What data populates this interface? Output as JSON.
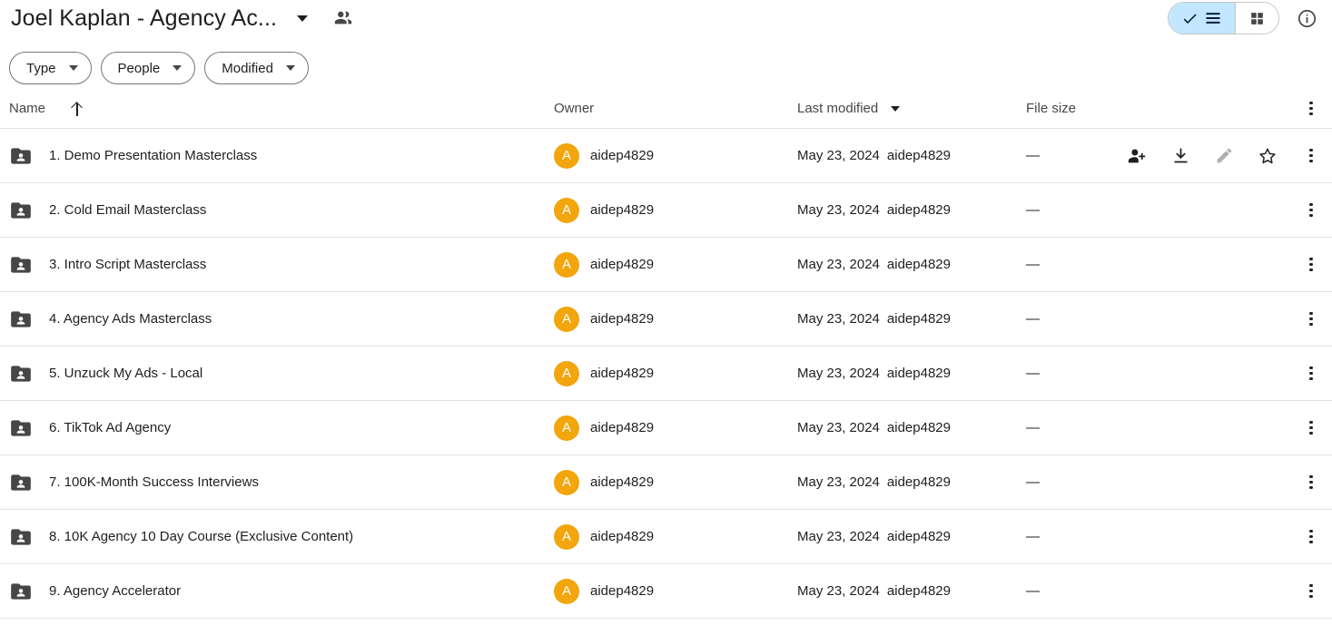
{
  "header": {
    "title": "Joel Kaplan - Agency Ac...",
    "title_caret_icon": "chevron-down-icon",
    "shared_icon": "people-icon",
    "view_toggle": {
      "list_label": "",
      "list_icon": "list-view-icon",
      "check_icon": "check-icon",
      "grid_icon": "grid-view-icon",
      "selected": "list"
    },
    "info_icon": "info-icon"
  },
  "filters": [
    {
      "label": "Type",
      "icon": "chevron-down-icon"
    },
    {
      "label": "People",
      "icon": "chevron-down-icon"
    },
    {
      "label": "Modified",
      "icon": "chevron-down-icon"
    }
  ],
  "columns": {
    "name": "Name",
    "name_sort_icon": "arrow-up-icon",
    "owner": "Owner",
    "modified": "Last modified",
    "modified_sort_icon": "triangle-down-icon",
    "size": "File size",
    "more_icon": "more-vertical-icon"
  },
  "row_actions": {
    "share": "person-add-icon",
    "download": "download-icon",
    "edit": "pencil-icon",
    "star": "star-icon",
    "more": "more-vertical-icon"
  },
  "files": [
    {
      "icon": "shared-folder-icon",
      "name": "1. Demo Presentation Masterclass",
      "owner_initial": "A",
      "owner": "aidep4829",
      "modified_date": "May 23, 2024",
      "modified_by": "aidep4829",
      "size": "—",
      "actions_visible": true
    },
    {
      "icon": "shared-folder-icon",
      "name": "2. Cold Email Masterclass",
      "owner_initial": "A",
      "owner": "aidep4829",
      "modified_date": "May 23, 2024",
      "modified_by": "aidep4829",
      "size": "—",
      "actions_visible": false
    },
    {
      "icon": "shared-folder-icon",
      "name": "3. Intro Script Masterclass",
      "owner_initial": "A",
      "owner": "aidep4829",
      "modified_date": "May 23, 2024",
      "modified_by": "aidep4829",
      "size": "—",
      "actions_visible": false
    },
    {
      "icon": "shared-folder-icon",
      "name": "4. Agency Ads Masterclass",
      "owner_initial": "A",
      "owner": "aidep4829",
      "modified_date": "May 23, 2024",
      "modified_by": "aidep4829",
      "size": "—",
      "actions_visible": false
    },
    {
      "icon": "shared-folder-icon",
      "name": "5. Unzuck My Ads - Local",
      "owner_initial": "A",
      "owner": "aidep4829",
      "modified_date": "May 23, 2024",
      "modified_by": "aidep4829",
      "size": "—",
      "actions_visible": false
    },
    {
      "icon": "shared-folder-icon",
      "name": "6. TikTok Ad Agency",
      "owner_initial": "A",
      "owner": "aidep4829",
      "modified_date": "May 23, 2024",
      "modified_by": "aidep4829",
      "size": "—",
      "actions_visible": false
    },
    {
      "icon": "shared-folder-icon",
      "name": "7. 100K-Month Success Interviews",
      "owner_initial": "A",
      "owner": "aidep4829",
      "modified_date": "May 23, 2024",
      "modified_by": "aidep4829",
      "size": "—",
      "actions_visible": false
    },
    {
      "icon": "shared-folder-icon",
      "name": "8. 10K Agency 10 Day Course (Exclusive Content)",
      "owner_initial": "A",
      "owner": "aidep4829",
      "modified_date": "May 23, 2024",
      "modified_by": "aidep4829",
      "size": "—",
      "actions_visible": false
    },
    {
      "icon": "shared-folder-icon",
      "name": "9. Agency Accelerator",
      "owner_initial": "A",
      "owner": "aidep4829",
      "modified_date": "May 23, 2024",
      "modified_by": "aidep4829",
      "size": "—",
      "actions_visible": false
    }
  ],
  "colors": {
    "avatar": "#f2a50c",
    "selected_toggle": "#c2e7ff",
    "folder": "#444746",
    "divider": "#e3e3e3"
  }
}
